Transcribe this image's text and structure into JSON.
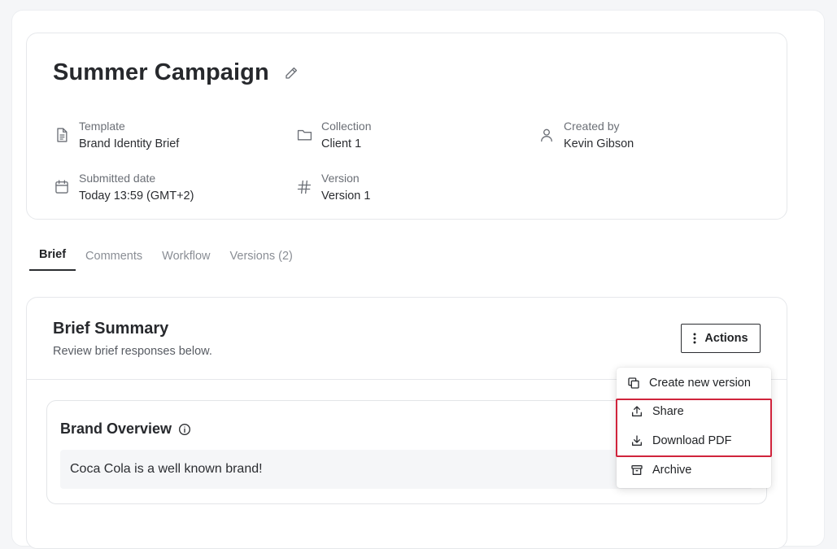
{
  "header": {
    "title": "Summer Campaign",
    "meta": {
      "template": {
        "label": "Template",
        "value": "Brand Identity Brief",
        "icon": "document-icon"
      },
      "collection": {
        "label": "Collection",
        "value": "Client 1",
        "icon": "folder-icon"
      },
      "created_by": {
        "label": "Created by",
        "value": "Kevin Gibson",
        "icon": "user-icon"
      },
      "submitted_date": {
        "label": "Submitted date",
        "value": "Today 13:59 (GMT+2)",
        "icon": "calendar-icon"
      },
      "version": {
        "label": "Version",
        "value": "Version 1",
        "icon": "hash-icon"
      }
    }
  },
  "tabs": [
    {
      "label": "Brief",
      "active": true
    },
    {
      "label": "Comments",
      "active": false
    },
    {
      "label": "Workflow",
      "active": false
    },
    {
      "label": "Versions (2)",
      "active": false
    }
  ],
  "summary": {
    "title": "Brief Summary",
    "subtitle": "Review brief responses below.",
    "actions_label": "Actions"
  },
  "actions_menu": [
    {
      "label": "Create new version",
      "icon": "copy-icon"
    },
    {
      "label": "Share",
      "icon": "share-icon"
    },
    {
      "label": "Download PDF",
      "icon": "download-icon"
    },
    {
      "label": "Archive",
      "icon": "archive-icon"
    }
  ],
  "brand_overview": {
    "title": "Brand Overview",
    "answer": "Coca Cola is a well known brand!"
  },
  "colors": {
    "highlight": "#d0243c",
    "text": "#2b2d31",
    "muted": "#6b6f76"
  }
}
